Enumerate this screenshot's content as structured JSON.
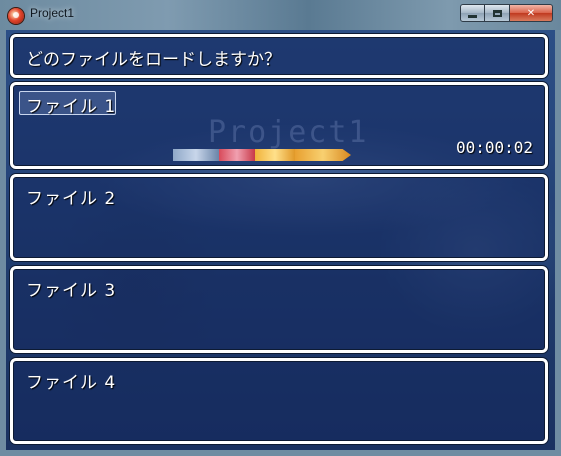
{
  "window": {
    "title": "Project1",
    "buttons": {
      "minimize": "",
      "maximize": "",
      "close": "✕"
    }
  },
  "help": {
    "text": "どのファイルをロードしますか？"
  },
  "slots": [
    {
      "label": "ファイル 1",
      "game_title": "Project1",
      "playtime": "00:00:02",
      "selected": true
    },
    {
      "label": "ファイル 2"
    },
    {
      "label": "ファイル 3"
    },
    {
      "label": "ファイル 4"
    }
  ],
  "colors": {
    "window_bg": "#1f3b6c",
    "panel_border": "#ffffff",
    "text": "#ffffff"
  }
}
